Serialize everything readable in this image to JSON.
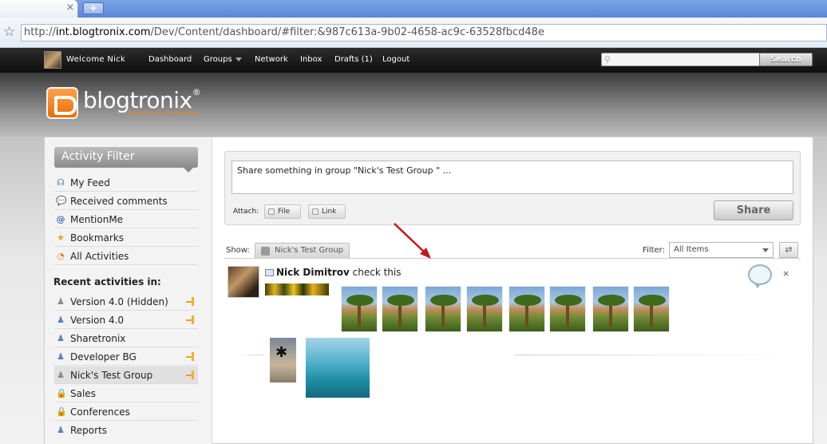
{
  "browser": {
    "tab_close": "×",
    "new_tab": "+",
    "url_scheme": "http://",
    "url_host": "int.blogtronix.com",
    "url_path": "/Dev/Content/dashboard/#filter:&987c613a-9b02-4658-ac9c-63528fbcd48e"
  },
  "topnav": {
    "welcome": "Welcome  Nick",
    "links": [
      "Dashboard",
      "Groups",
      "Network",
      "Inbox",
      "Drafts (1)",
      "Logout"
    ],
    "search_label": "Search"
  },
  "logo": {
    "name": "blogtronix",
    "reg": "®",
    "tagline": "Enterprise Social Platform"
  },
  "sidebar": {
    "filter_title": "Activity Filter",
    "filters": [
      {
        "label": "My Feed",
        "icon": "feed-icon"
      },
      {
        "label": "Received comments",
        "icon": "comment-icon"
      },
      {
        "label": "MentionMe",
        "icon": "at-icon"
      },
      {
        "label": "Bookmarks",
        "icon": "star-icon"
      },
      {
        "label": "All Activities",
        "icon": "rss-icon"
      }
    ],
    "recent_title": "Recent activities in:",
    "groups": [
      {
        "label": "Version 4.0 (Hidden)",
        "icon": "group-icon",
        "pinned": true
      },
      {
        "label": "Version 4.0",
        "icon": "group-icon",
        "pinned": true
      },
      {
        "label": "Sharetronix",
        "icon": "group-icon",
        "pinned": false
      },
      {
        "label": "Developer BG",
        "icon": "group-icon",
        "pinned": true
      },
      {
        "label": "Nick's Test Group",
        "icon": "group-icon",
        "pinned": true,
        "active": true
      },
      {
        "label": "Sales",
        "icon": "lock-icon",
        "pinned": false
      },
      {
        "label": "Conferences",
        "icon": "lock-icon",
        "pinned": false
      },
      {
        "label": "Reports",
        "icon": "group-icon",
        "pinned": false
      }
    ]
  },
  "share": {
    "placeholder": "Share something in group \"Nick's Test Group \" ...",
    "attach_label": "Attach:",
    "file_label": "File",
    "link_label": "Link",
    "share_button": "Share"
  },
  "feed": {
    "show_label": "Show:",
    "group_tab": "Nick's Test Group",
    "filter_label": "Filter:",
    "filter_value": "All Items",
    "refresh_icon": "⇄"
  },
  "post": {
    "author": "Nick Dimitrov",
    "text": " check this",
    "close": "×"
  },
  "colors": {
    "accent_orange": "#e8841e",
    "nav_dark": "#1a1a1a",
    "arrow_red": "#c0181b"
  }
}
